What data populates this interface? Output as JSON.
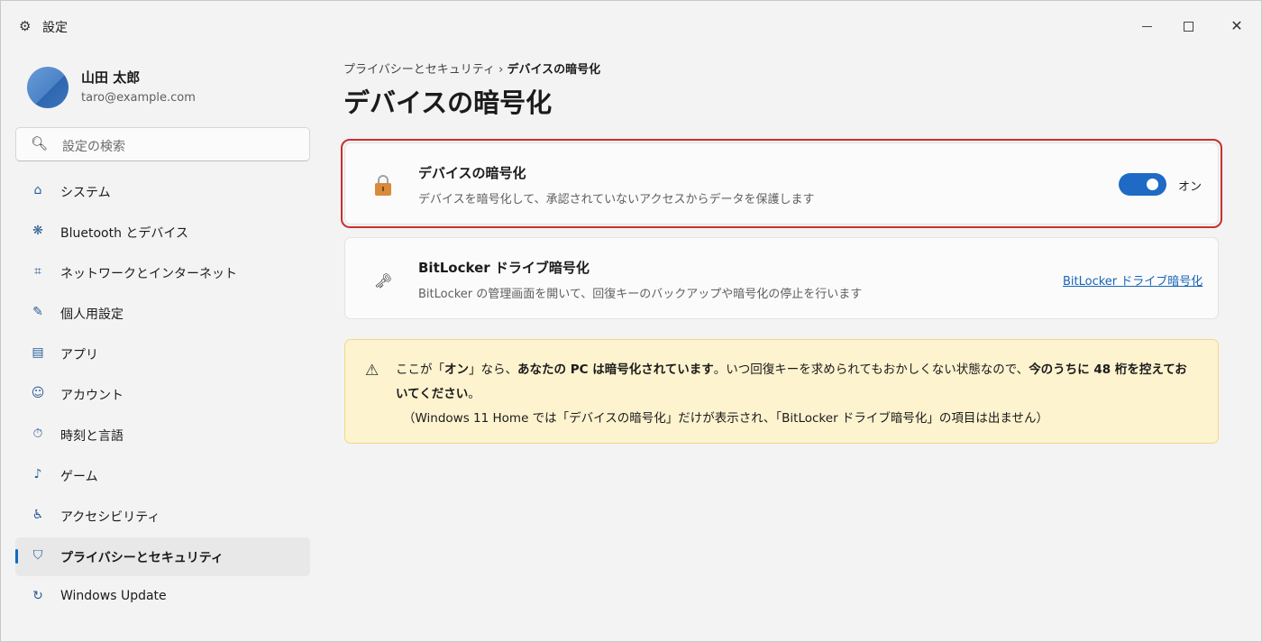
{
  "window": {
    "title": "設定",
    "icons": {
      "app": "gear-icon",
      "minimize": "minimize-icon",
      "maximize": "maximize-icon",
      "close": "close-icon"
    }
  },
  "user": {
    "name": "山田 太郎",
    "email": "taro@example.com"
  },
  "search": {
    "placeholder": "設定の検索",
    "icon": "search-icon"
  },
  "sidebar": {
    "items": [
      {
        "label": "システム",
        "icon": "home-icon",
        "glyph": "⌂",
        "active": false
      },
      {
        "label": "Bluetooth とデバイス",
        "icon": "bluetooth-icon",
        "glyph": "❋",
        "active": false
      },
      {
        "label": "ネットワークとインターネット",
        "icon": "network-icon",
        "glyph": "⌗",
        "active": false
      },
      {
        "label": "個人用設定",
        "icon": "brush-icon",
        "glyph": "✎",
        "active": false
      },
      {
        "label": "アプリ",
        "icon": "apps-icon",
        "glyph": "▤",
        "active": false
      },
      {
        "label": "アカウント",
        "icon": "account-icon",
        "glyph": "☺",
        "active": false
      },
      {
        "label": "時刻と言語",
        "icon": "clock-icon",
        "glyph": "⏱",
        "active": false
      },
      {
        "label": "ゲーム",
        "icon": "game-icon",
        "glyph": "♪",
        "active": false
      },
      {
        "label": "アクセシビリティ",
        "icon": "accessibility-icon",
        "glyph": "♿",
        "active": false
      },
      {
        "label": "プライバシーとセキュリティ",
        "icon": "shield-icon",
        "glyph": "⛉",
        "active": true
      },
      {
        "label": "Windows Update",
        "icon": "update-icon",
        "glyph": "↻",
        "active": false
      }
    ]
  },
  "breadcrumb": {
    "parent": "プライバシーとセキュリティ",
    "separator": "›",
    "current": "デバイスの暗号化"
  },
  "page": {
    "title": "デバイスの暗号化"
  },
  "cards": {
    "encryption": {
      "title": "デバイスの暗号化",
      "description": "デバイスを暗号化して、承認されていないアクセスからデータを保護します",
      "icon": "lock-icon",
      "toggle_state": "オン",
      "toggle_on": true
    },
    "bitlocker": {
      "title": "BitLocker ドライブ暗号化",
      "description": "BitLocker の管理画面を開いて、回復キーのバックアップや暗号化の停止を行います",
      "icon": "key-icon",
      "link": "BitLocker ドライブ暗号化"
    }
  },
  "warning": {
    "icon": "warning-icon",
    "segments": [
      {
        "text": "ここが「",
        "bold": false
      },
      {
        "text": "オン",
        "bold": true
      },
      {
        "text": "」なら、",
        "bold": false
      },
      {
        "text": "あなたの PC は暗号化されています",
        "bold": true
      },
      {
        "text": "。いつ回復キーを求められてもおかしくない状態なので、",
        "bold": false
      },
      {
        "text": "今のうちに 48 桁を控えておいてください",
        "bold": true
      },
      {
        "text": "。",
        "bold": false
      }
    ],
    "note": "（Windows 11 Home では「デバイスの暗号化」だけが表示され、「BitLocker ドライブ暗号化」の項目は出ません）"
  },
  "colors": {
    "accent": "#0f6cbd",
    "toggle": "#1f6ac4",
    "highlight": "#c8302d",
    "warning_bg": "#fdf3cf",
    "link": "#1765b8"
  }
}
